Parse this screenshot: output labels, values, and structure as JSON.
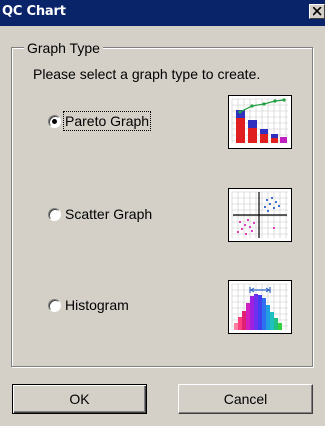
{
  "window": {
    "title": "QC Chart"
  },
  "graph_type": {
    "group_title": "Graph Type",
    "instruction": "Please select a graph type to create.",
    "options": [
      {
        "label": "Pareto Graph",
        "selected": true,
        "icon": "pareto-chart-icon"
      },
      {
        "label": "Scatter Graph",
        "selected": false,
        "icon": "scatter-chart-icon"
      },
      {
        "label": "Histogram",
        "selected": false,
        "icon": "histogram-chart-icon"
      }
    ]
  },
  "buttons": {
    "ok": "OK",
    "cancel": "Cancel"
  },
  "colors": {
    "titlebar": "#0a246a",
    "face": "#d4d0c8"
  }
}
